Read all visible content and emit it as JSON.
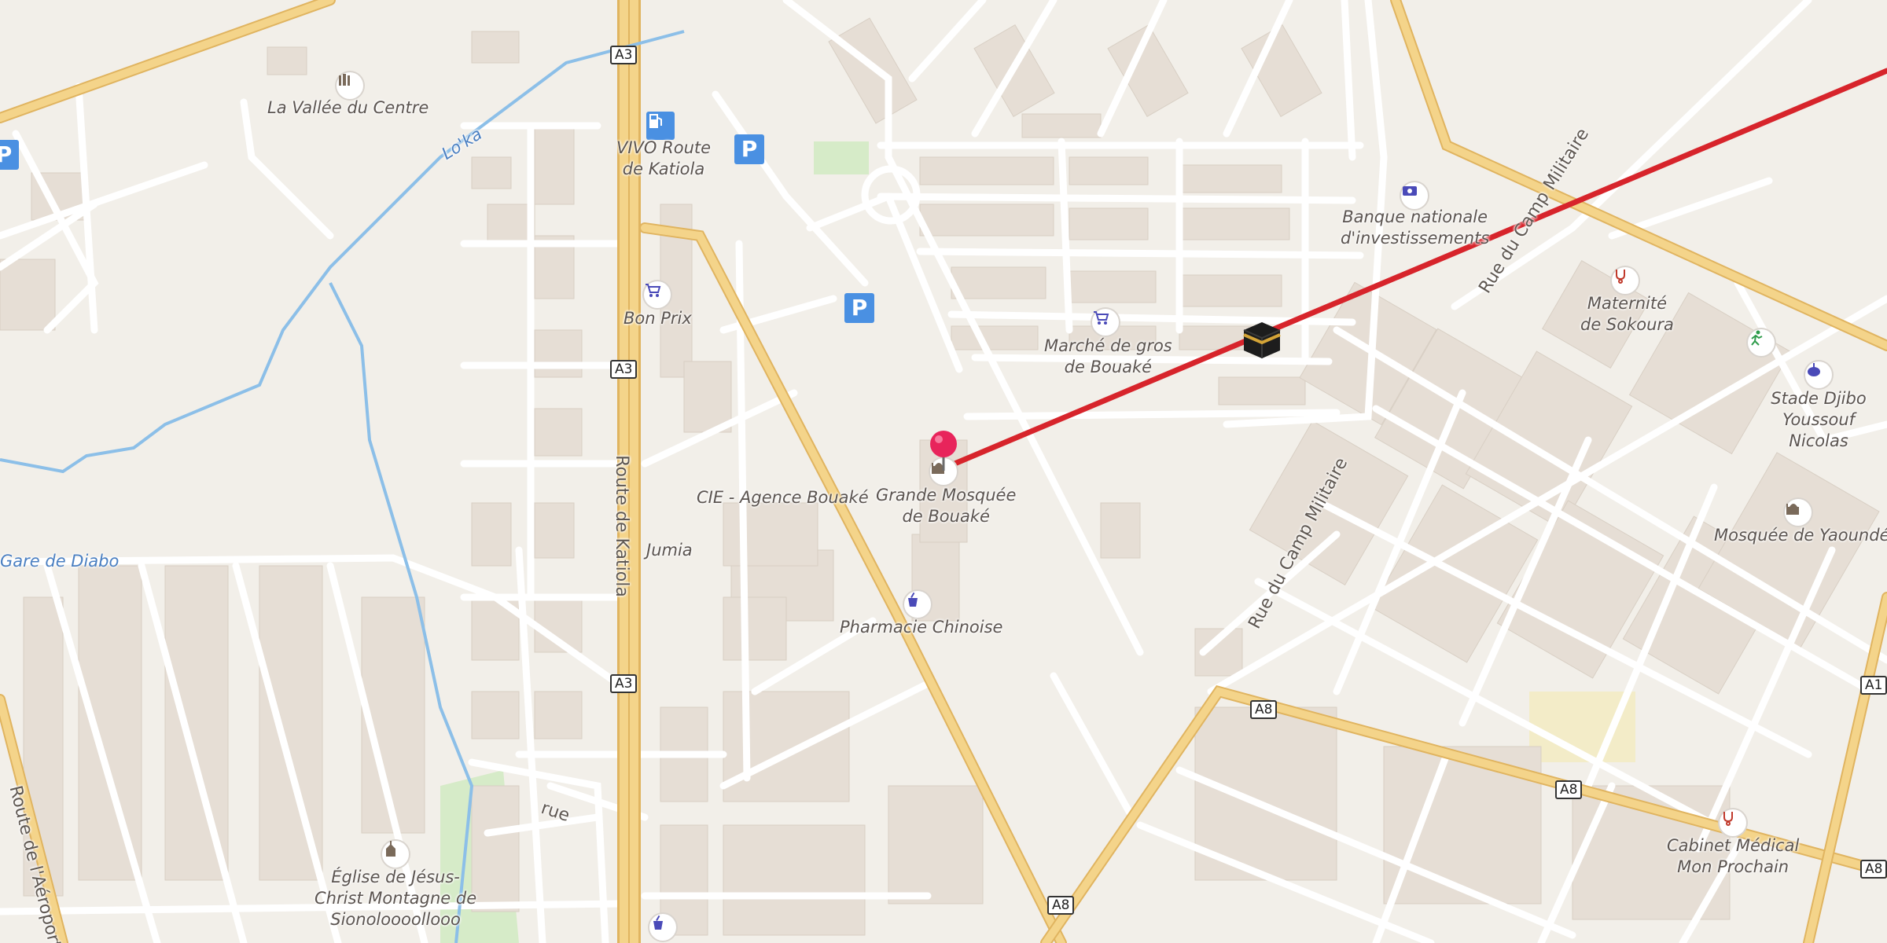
{
  "map": {
    "background": "#f2efe9",
    "road_major_color": "#f4d48a",
    "road_casing_color": "#e0b460",
    "route_line_color": "#d7242b",
    "water_color": "#8cbfe8",
    "park_color": "#d6ebc8"
  },
  "shields": {
    "a3_1": "A3",
    "a3_2": "A3",
    "a3_3": "A3",
    "a8_1": "A8",
    "a8_2": "A8",
    "a8_3": "A8",
    "a8_4": "A8",
    "a1": "A1"
  },
  "labels": {
    "vallee": "La Vallée du Centre",
    "vivo": "VIVO Route\nde Katiola",
    "bon_prix": "Bon Prix",
    "banque": "Banque nationale\nd'investissements",
    "maternite": "Maternité\nde Sokoura",
    "stade": "Stade Djibo\nYoussouf Nicolas",
    "marche": "Marché de gros\nde Bouaké",
    "mosquee_grande": "Grande Mosquée\nde Bouaké",
    "cie": "CIE - Agence Bouaké",
    "jumia": "Jumia",
    "pharmacie": "Pharmacie Chinoise",
    "mosquee_yaounde": "Mosquée de Yaoundé",
    "gare": "Gare de Diabo",
    "eglise": "Église de Jésus-\nChrist Montagne de\nSionoloooollooo",
    "cabinet": "Cabinet Médical\nMon Prochain",
    "river": "Lo'ka",
    "route_katiola": "Route de Katiola",
    "rue_camp_1": "Rue du Camp Militaire",
    "rue_camp_2": "Rue du Camp Militaire",
    "route_aeroport": "Route de l'Aéroport",
    "rue": "rue"
  },
  "icons": [
    "monument-icon",
    "fuel-icon",
    "parking-icon",
    "shopping-cart-icon",
    "bank-icon",
    "hospital-icon",
    "sports-icon",
    "stadium-icon",
    "mosque-icon",
    "pharmacy-icon",
    "church-icon",
    "kaaba-icon",
    "location-pin-icon"
  ]
}
